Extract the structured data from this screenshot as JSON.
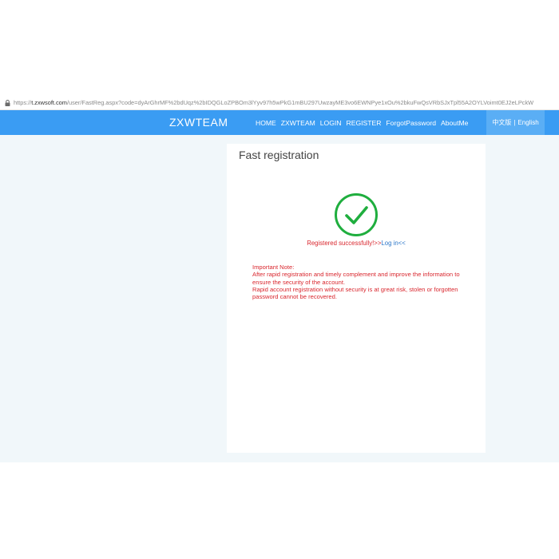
{
  "browser": {
    "url_scheme": "https://",
    "url_host": "t.zxwsoft.com",
    "url_path": "/user/FastReg.aspx?code=dyArGhrMF%2bdUqz%2bIDQGLoZPBOm3lYyv97h5wPkG1mBU297UwzayME3vo6EWNPye1xOu%2bkuFwQsVRbSJxTpl55A2OYLVoimt0EJ2eLPckW"
  },
  "navbar": {
    "brand": "ZXWTEAM",
    "links": [
      "HOME",
      "ZXWTEAM",
      "LOGIN",
      "REGISTER",
      "ForgotPassword",
      "AboutMe"
    ],
    "lang_chinese": "中文版",
    "lang_separator": "|",
    "lang_english": "English"
  },
  "card": {
    "title": "Fast registration",
    "success_text": "Registered successfully!>>",
    "login_link": "Log in<<",
    "note_title": "Important Note:",
    "note_line1": "After rapid registration and timely complement and improve the information to ensure the security of the account.",
    "note_line2": "Rapid account registration without security is at great risk, stolen or forgotten password cannot be recovered."
  },
  "colors": {
    "navbar": "#3a9cf3",
    "success_green": "#1fae3e",
    "note_red": "#d9272e",
    "link_blue": "#2e78c9"
  },
  "icons": {
    "lock": "lock-icon",
    "success": "check-circle-icon"
  }
}
